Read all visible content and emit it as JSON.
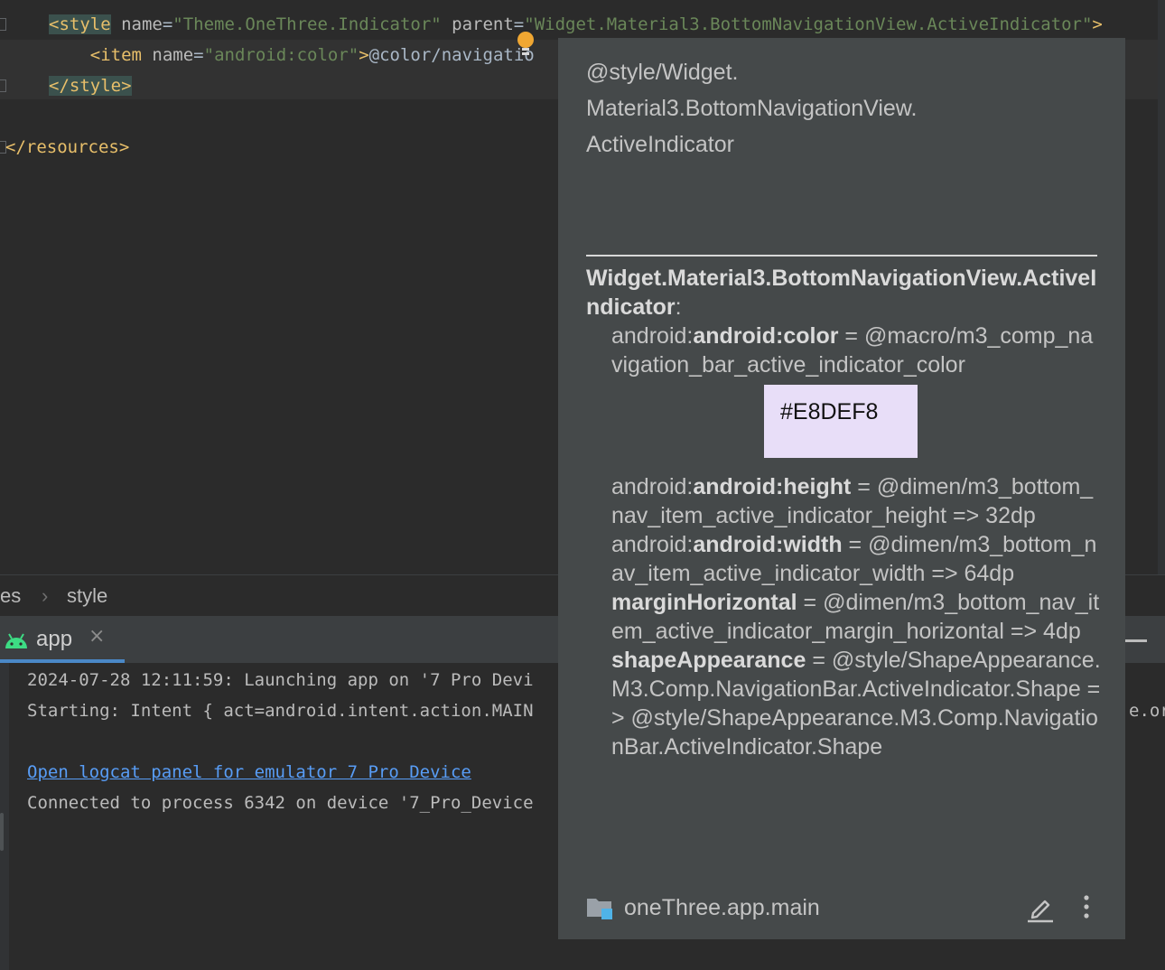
{
  "editor": {
    "line1": {
      "open": "<style",
      "name_attr": " name",
      "eq": "=",
      "name_val": "\"Theme.OneThree.Indicator\"",
      "parent_attr": " parent",
      "eq2": "=",
      "parent_val": "\"Widget.Material3.BottomNavigationView.ActiveIndicator\"",
      "close": ">"
    },
    "line2": {
      "indent": "    ",
      "open": "<item",
      "name_attr": " name",
      "eq": "=",
      "name_val": "\"android:color\"",
      "gt": ">",
      "text": "@color/navigatio"
    },
    "line3": {
      "close": "</style>"
    },
    "line4": {
      "close": "</resources>"
    }
  },
  "breadcrumb": {
    "item1": "es",
    "separator": "›",
    "item2": "style"
  },
  "run_tab": {
    "label": "app",
    "icon": "android-icon",
    "close": "×"
  },
  "console": {
    "lines": [
      "2024-07-28 12:11:59: Launching app on '7 Pro Devi",
      "Starting: Intent { act=android.intent.action.MAIN",
      "Connected to process 6342 on device '7_Pro_Device"
    ],
    "link": "Open logcat panel for emulator 7 Pro Device",
    "overflow_right": "e.or"
  },
  "popup": {
    "header_lines": [
      "@style/Widget.",
      "Material3.BottomNavigationView.",
      "ActiveIndicator"
    ],
    "title_bold": "Widget.Material3.BottomNavigationView.ActiveIndicator",
    "title_colon": ":",
    "attrs": [
      {
        "prefix": "android:",
        "name": "android:color",
        "rest": " = @macro/m3_comp_navigation_bar_active_indicator_color"
      },
      {
        "prefix": "android:",
        "name": "android:height",
        "rest": " = @dimen/m3_bottom_nav_item_active_indicator_height => 32dp"
      },
      {
        "prefix": "android:",
        "name": "android:width",
        "rest": " = @dimen/m3_bottom_nav_item_active_indicator_width => 64dp"
      },
      {
        "prefix": "",
        "name": "marginHorizontal",
        "rest": " = @dimen/m3_bottom_nav_item_active_indicator_margin_horizontal => 4dp"
      },
      {
        "prefix": "",
        "name": "shapeAppearance",
        "rest": " = @style/ShapeAppearance.M3.Comp.NavigationBar.ActiveIndicator.Shape => @style/ShapeAppearance.M3.Comp.NavigationBar.ActiveIndicator.Shape"
      }
    ],
    "swatch": {
      "label": "#E8DEF8",
      "color": "#E8DEF8"
    },
    "module": "oneThree.app.main",
    "icons": {
      "module": "folder-module-icon",
      "edit": "pencil-icon",
      "more": "more-vertical-icon"
    }
  },
  "colors": {
    "editor_bg": "#2b2b2b",
    "popup_bg": "#45494a",
    "tag": "#e8bf6a",
    "attr": "#bababa",
    "string": "#6a8759",
    "link": "#589df6",
    "android_green": "#3ddc84"
  }
}
